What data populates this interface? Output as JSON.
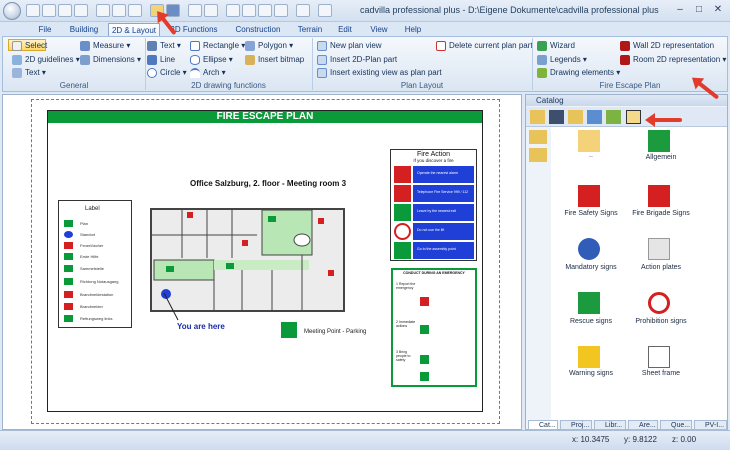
{
  "window": {
    "title": "cadvilla professional plus - D:\\Eigene Dokumente\\cadvilla professional plus 7\\Projects\\buero.cvp - [Neues...",
    "minimize": "–",
    "maximize": "□",
    "close": "✕"
  },
  "tabs": [
    {
      "label": "File"
    },
    {
      "label": "Building"
    },
    {
      "label": "2D & Layout"
    },
    {
      "label": "3D Functions"
    },
    {
      "label": "Construction"
    },
    {
      "label": "Terrain"
    },
    {
      "label": "Edit"
    },
    {
      "label": "View"
    },
    {
      "label": "Help"
    }
  ],
  "ribbon": {
    "general": {
      "label": "General",
      "select": "Select",
      "measure": "Measure",
      "guidelines": "2D guidelines",
      "dimensions": "Dimensions",
      "text": "Text"
    },
    "drawing": {
      "label": "2D drawing functions",
      "text": "Text",
      "line": "Line",
      "circle": "Circle",
      "rectangle": "Rectangle",
      "ellipse": "Ellipse",
      "arch": "Arch",
      "polygon": "Polygon",
      "insert_bitmap": "Insert bitmap"
    },
    "plan_layout": {
      "label": "Plan Layout",
      "new_plan_view": "New plan view",
      "insert_2d_plan_part": "Insert 2D-Plan part",
      "insert_existing": "Insert existing view as plan part",
      "delete_current": "Delete current plan part"
    },
    "fire_escape": {
      "label": "Fire Escape Plan",
      "wizard": "Wizard",
      "legends": "Legends",
      "drawing_elements": "Drawing elements",
      "wall_2d": "Wall 2D representation",
      "room_2d": "Room 2D representation"
    }
  },
  "plan": {
    "title": "FIRE ESCAPE PLAN",
    "office": "Office Salzburg, 2. floor - Meeting room 3",
    "legend_title": "Label",
    "legend_items": [
      "Plan",
      "Standort",
      "Feuerlöscher",
      "Erste Hilfe",
      "Sammelstelle",
      "Richtung Notausgang",
      "Brandmeldestation",
      "Brandmelder",
      "Rettungsweg links"
    ],
    "you_are_here": "You are here",
    "meeting_point": "Meeting Point - Parking",
    "fire_action_title": "Fire Action",
    "fire_action_sub": "If you discover a fire",
    "fire_action_steps": [
      "Operate the nearest alarm",
      "Telephone Fire Service 999 / 112",
      "Leave by the nearest exit",
      "Do not use the lift",
      "Go to the assembly point"
    ],
    "conduct_title": "CONDUCT DURING AN EMERGENCY",
    "conduct_steps": [
      "1 Report the emergency",
      "2 Immediate actions",
      "3 Bring people to safety"
    ]
  },
  "catalog": {
    "title": "Catalog",
    "items": [
      {
        "label": "..",
        "icon": "folder-up-icon"
      },
      {
        "label": "Allgemein",
        "icon": "green-arrow-icon"
      },
      {
        "label": "Fire Safety Signs",
        "icon": "fire-extinguisher-sign-icon"
      },
      {
        "label": "Fire Brigade Signs",
        "icon": "fire-brigade-sign-icon"
      },
      {
        "label": "Mandatory signs",
        "icon": "mandatory-sign-icon"
      },
      {
        "label": "Action plates",
        "icon": "action-plate-icon"
      },
      {
        "label": "Rescue signs",
        "icon": "rescue-sign-icon"
      },
      {
        "label": "Prohibition signs",
        "icon": "prohibition-sign-icon"
      },
      {
        "label": "Warning signs",
        "icon": "warning-sign-icon"
      },
      {
        "label": "Sheet frame",
        "icon": "sheet-frame-icon"
      }
    ],
    "bottom_tabs": [
      "Cat...",
      "Proj...",
      "Libr...",
      "Are...",
      "Que...",
      "PV-I..."
    ]
  },
  "status": {
    "x": "x: 10.3475",
    "y": "y: 9.8122",
    "z": "z: 0.00"
  },
  "colors": {
    "accent_green": "#0a9a3a",
    "sign_red": "#d42020",
    "sign_blue": "#1f3fd6",
    "highlight_arrow": "#e23a2b"
  }
}
